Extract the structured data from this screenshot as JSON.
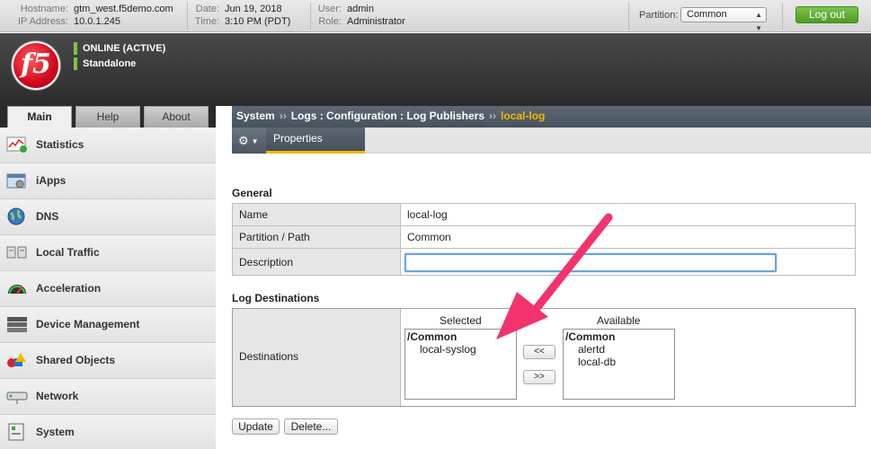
{
  "topbar": {
    "hostname_label": "Hostname:",
    "hostname": "gtm_west.f5demo.com",
    "ip_label": "IP Address:",
    "ip": "10.0.1.245",
    "date_label": "Date:",
    "date": "Jun 19, 2018",
    "time_label": "Time:",
    "time": "3:10 PM (PDT)",
    "user_label": "User:",
    "user": "admin",
    "role_label": "Role:",
    "role": "Administrator",
    "partition_label": "Partition:",
    "partition_value": "Common",
    "logout_label": "Log out"
  },
  "header": {
    "logo_text": "f5",
    "status_primary": "ONLINE (ACTIVE)",
    "status_secondary": "Standalone",
    "status_color": "#7cc34c"
  },
  "tabs": [
    "Main",
    "Help",
    "About"
  ],
  "sidebar": {
    "items": [
      {
        "label": "Statistics",
        "icon": "statistics-icon"
      },
      {
        "label": "iApps",
        "icon": "iapps-icon"
      },
      {
        "label": "DNS",
        "icon": "dns-globe-icon"
      },
      {
        "label": "Local Traffic",
        "icon": "local-traffic-icon"
      },
      {
        "label": "Acceleration",
        "icon": "acceleration-gauge-icon"
      },
      {
        "label": "Device Management",
        "icon": "device-management-icon"
      },
      {
        "label": "Shared Objects",
        "icon": "shared-objects-icon"
      },
      {
        "label": "Network",
        "icon": "network-icon"
      },
      {
        "label": "System",
        "icon": "system-icon"
      }
    ]
  },
  "breadcrumb": {
    "items": [
      "System",
      "Logs : Configuration : Log Publishers"
    ],
    "separator": "››",
    "current": "local-log",
    "current_color": "#f5b700"
  },
  "subbar": {
    "gear_icon": "gear-icon",
    "tab_label": "Properties"
  },
  "general": {
    "title": "General",
    "rows": [
      {
        "key": "Name",
        "value": "local-log"
      },
      {
        "key": "Partition / Path",
        "value": "Common"
      },
      {
        "key": "Description",
        "value": ""
      }
    ]
  },
  "destinations": {
    "title": "Log Destinations",
    "key": "Destinations",
    "selected_label": "Selected",
    "available_label": "Available",
    "selected": {
      "group": "/Common",
      "items": [
        "local-syslog"
      ]
    },
    "available": {
      "group": "/Common",
      "items": [
        "alertd",
        "local-db"
      ]
    },
    "move_left": "<<",
    "move_right": ">>"
  },
  "actions": {
    "update": "Update",
    "delete": "Delete..."
  },
  "annotation": {
    "arrow_color": "#f2336e"
  }
}
